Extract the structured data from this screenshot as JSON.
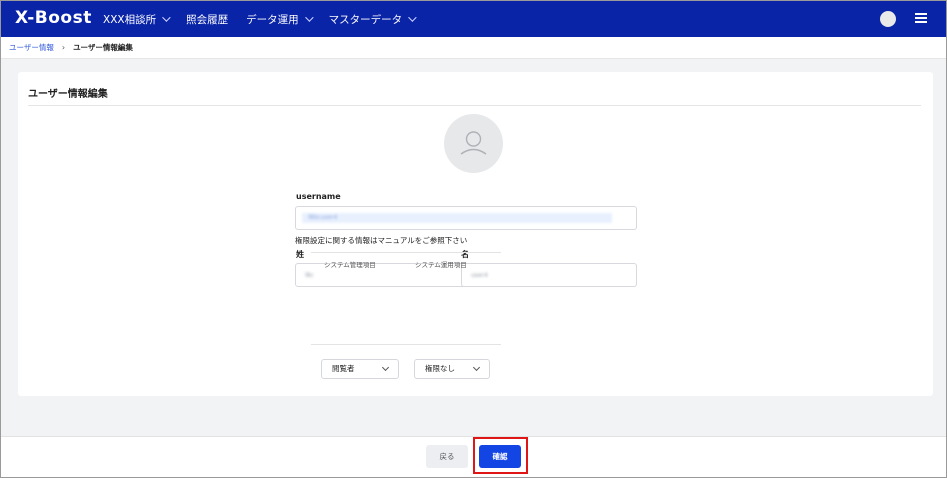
{
  "app": {
    "logo": "X-Boost"
  },
  "nav": {
    "items": [
      {
        "label": "XXX相談所"
      },
      {
        "label": "照会履歴"
      },
      {
        "label": "データ運用"
      },
      {
        "label": "マスターデータ"
      }
    ]
  },
  "breadcrumb": {
    "parent": "ユーザー情報",
    "current": "ユーザー情報編集"
  },
  "page": {
    "title": "ユーザー情報編集"
  },
  "form": {
    "username_label": "username",
    "username_value": "l8bcuser4",
    "last_name_label": "姓",
    "last_name_value": "l8c",
    "first_name_label": "名",
    "first_name_value": "user4"
  },
  "permissions": {
    "note": "権限設定に関する情報はマニュアルをご参照下さい",
    "columns": [
      "システム管理項目",
      "システム運用項目"
    ],
    "system_admin_value": "閲覧者",
    "system_ops_value": "権限なし"
  },
  "footer": {
    "back_label": "戻る",
    "confirm_label": "確認"
  }
}
